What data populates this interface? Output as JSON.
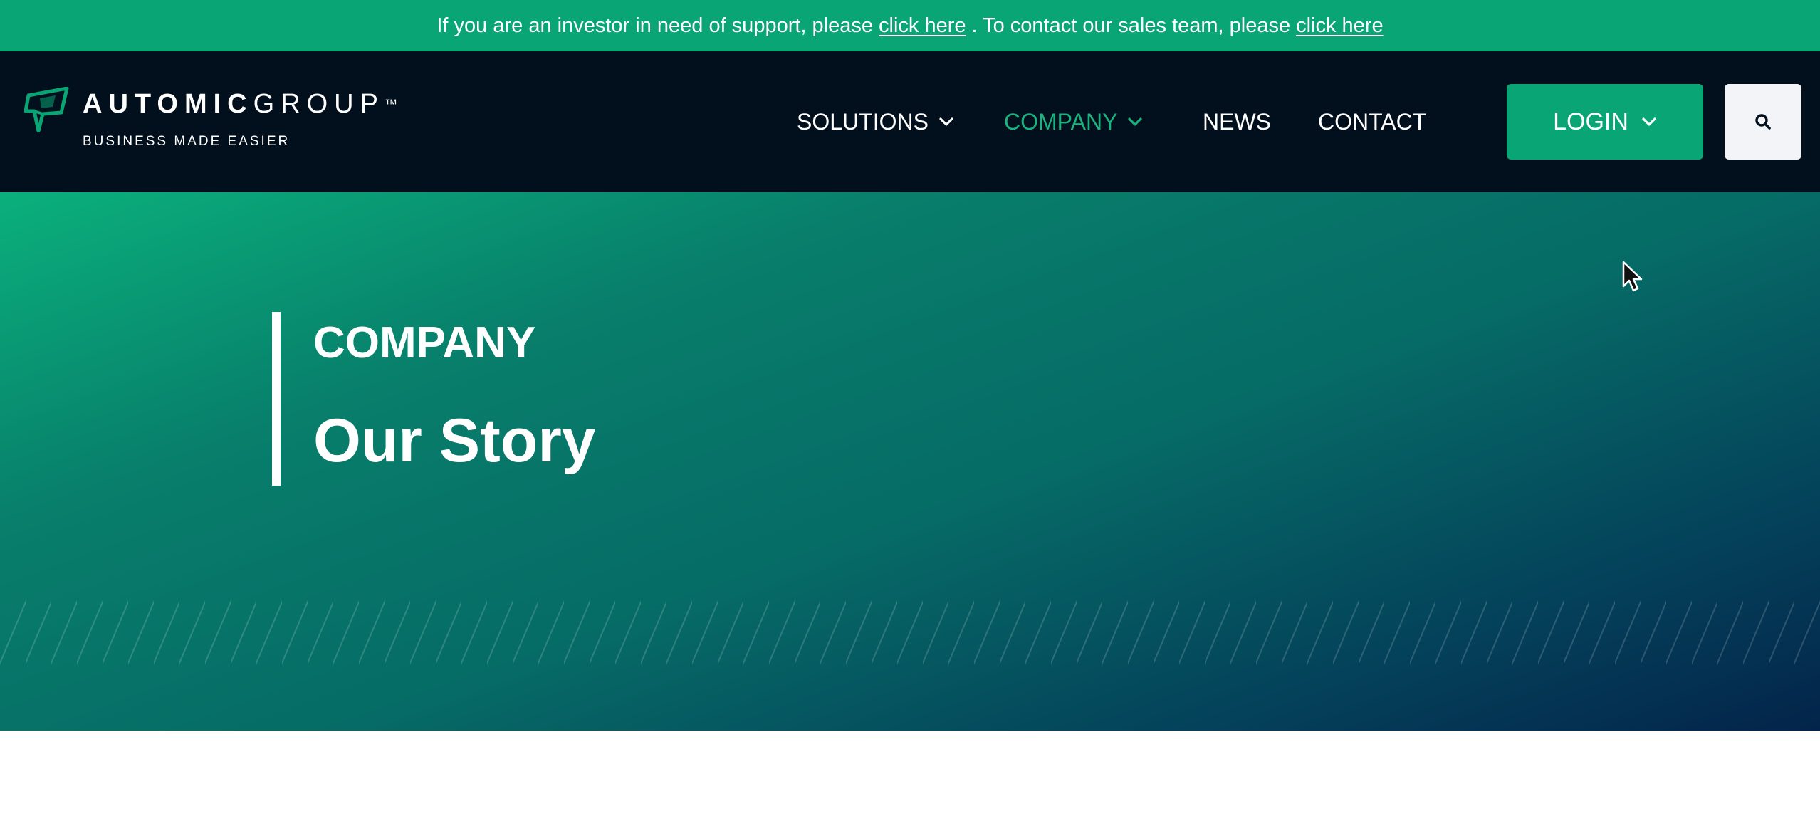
{
  "announcement": {
    "text_before": "If you are an investor in need of support, please",
    "link1": "click here",
    "text_middle": ". To contact our sales team, please",
    "link2": "click here"
  },
  "header": {
    "logo": {
      "word_bold": "AUTOMIC",
      "word_light": "GROUP",
      "trademark": "™",
      "tagline": "BUSINESS MADE EASIER"
    },
    "nav": {
      "solutions": "SOLUTIONS",
      "company": "COMPANY",
      "news": "NEWS",
      "contact": "CONTACT"
    },
    "login_label": "LOGIN",
    "icons": {
      "chevron": "chevron-down-icon",
      "search": "search-icon",
      "logo_mark": "automic-logo-mark"
    }
  },
  "hero": {
    "eyebrow": "COMPANY",
    "title": "Our Story"
  },
  "colors": {
    "brand_green": "#0aa574",
    "active_nav": "#19b380",
    "header_bg": "#020f1c",
    "hero_start": "#0ab07c",
    "hero_end": "#03244a"
  }
}
